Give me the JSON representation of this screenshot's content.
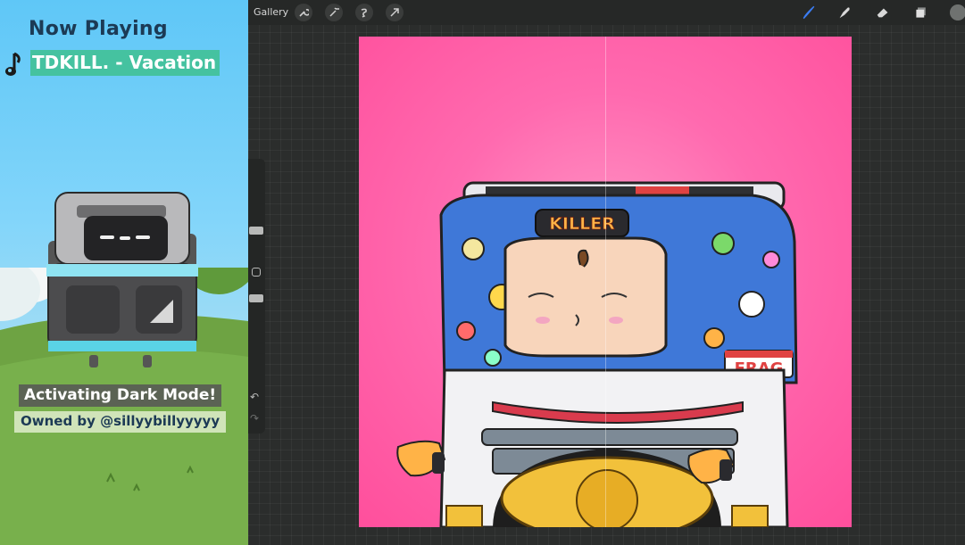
{
  "overlay": {
    "now_playing_label": "Now Playing",
    "track_title": "TDKILL. - Vacation",
    "status_label": "Activating Dark Mode!",
    "owner_label": "Owned by @sillyybillyyyyy",
    "icon": "music-note-icon"
  },
  "app": {
    "gallery_label": "Gallery",
    "left_tools": [
      "wrench-icon",
      "magic-wand-icon",
      "selection-icon",
      "transform-arrow-icon"
    ],
    "right_tools": [
      "brush-icon",
      "smudge-icon",
      "eraser-icon",
      "layers-icon",
      "color-icon"
    ],
    "accent": "#3b7cf2",
    "canvas_color": "#ff5fa8",
    "artwork_label": "KILLER",
    "artwork_label_2": "FRAG"
  }
}
